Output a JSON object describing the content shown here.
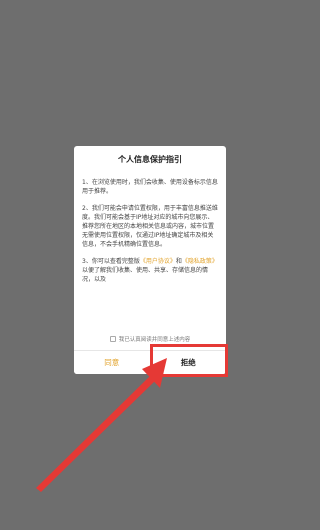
{
  "dialog": {
    "title": "个人信息保护指引",
    "paragraphs": [
      "1、在浏览使用时，我们会收集、使用设备标示信息用于推荐。",
      "2、我们可能会申请位置权限，用于丰富信息推送维度。我们可能会基于IP地址对应的城市向您展示、推荐您所在地区的本地相关信息或内容，城市位置无需使用位置权限，仅通过IP地址确定城市及相关信息，不会手机精确位置信息。"
    ],
    "p3": {
      "prefix": "3、你可以查看完整版",
      "link1": "《用户协议》",
      "mid": "和",
      "link2": "《隐私政策》",
      "suffix": "以便了解我们收集、使用、共享、存储信息的情况，以及"
    },
    "consent_label": "我已认真阅读并同意上述内容",
    "agree_label": "同意",
    "reject_label": "拒绝"
  },
  "colors": {
    "backdrop": "#6e6e6e",
    "accent": "#e2a32b",
    "annotation": "#e53935"
  }
}
